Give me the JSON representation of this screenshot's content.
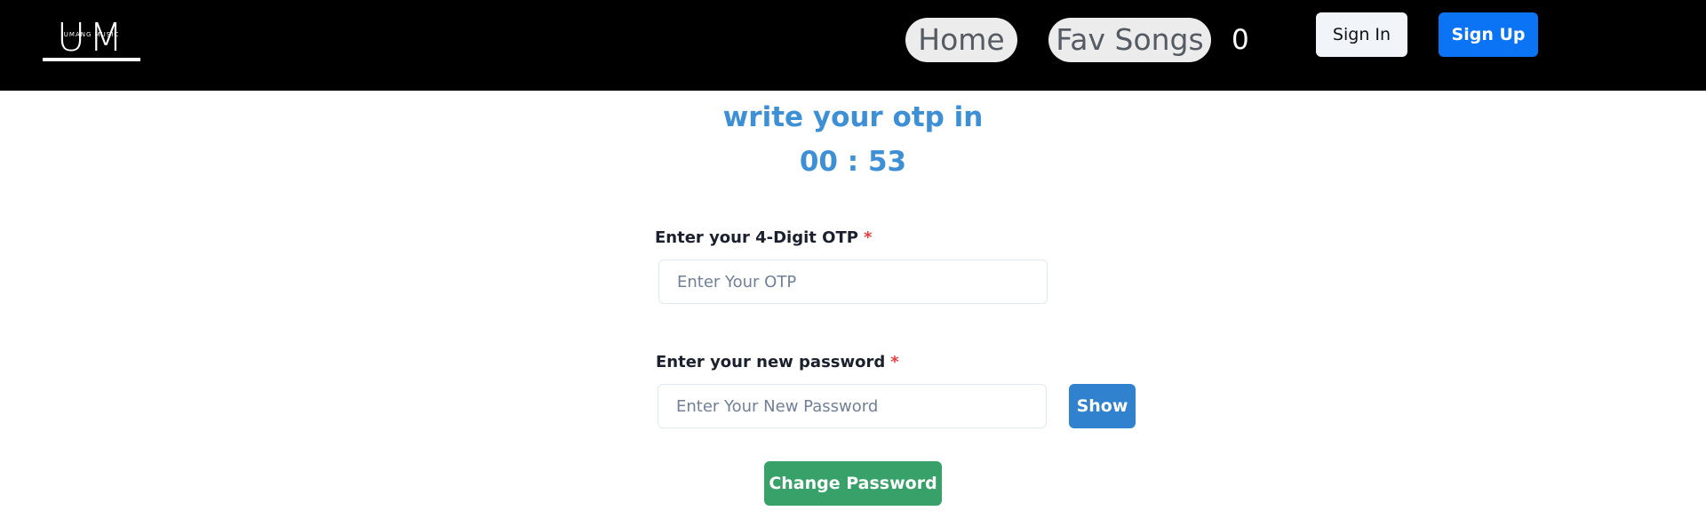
{
  "header": {
    "logo": {
      "letters": "UM",
      "subtitle": "UMANG MUSIC"
    },
    "nav": {
      "home_label": "Home",
      "fav_label": "Fav Songs",
      "fav_count": "0"
    },
    "auth": {
      "signin_label": "Sign In",
      "signup_label": "Sign Up"
    }
  },
  "main": {
    "heading": "write your otp in",
    "timer": "00 : 53",
    "otp": {
      "label": "Enter your 4-Digit OTP",
      "required_mark": "*",
      "placeholder": "Enter Your OTP",
      "value": ""
    },
    "password": {
      "label": "Enter your new password",
      "required_mark": "*",
      "placeholder": "Enter Your New Password",
      "value": ""
    },
    "show_label": "Show",
    "submit_label": "Change Password"
  },
  "colors": {
    "navbar": "#000000",
    "accent_blue": "#3d8fd6",
    "signup": "#0b74f5",
    "show": "#3182ce",
    "submit": "#38a169",
    "required": "#e53e3e"
  }
}
